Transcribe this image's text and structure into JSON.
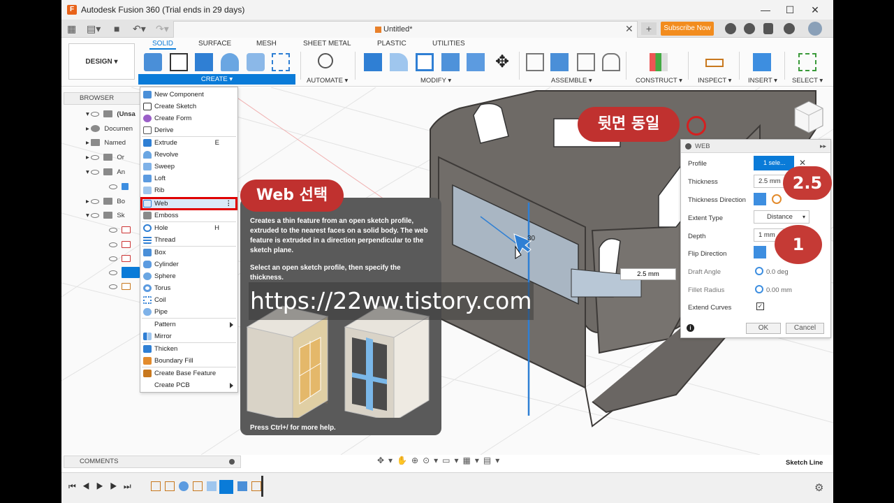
{
  "window": {
    "title": "Autodesk Fusion 360 (Trial ends in 29 days)"
  },
  "tab": {
    "doc_title": "Untitled*",
    "subscribe": "Subscribe Now"
  },
  "ribbon": {
    "workspace": "DESIGN ▾",
    "tabs": [
      "SOLID",
      "SURFACE",
      "MESH",
      "SHEET METAL",
      "PLASTIC",
      "UTILITIES"
    ],
    "groups": [
      "CREATE ▾",
      "AUTOMATE ▾",
      "MODIFY ▾",
      "ASSEMBLE ▾",
      "CONSTRUCT ▾",
      "INSPECT ▾",
      "INSERT ▾",
      "SELECT ▾"
    ]
  },
  "browser": {
    "title": "BROWSER",
    "rows": [
      "(Unsa",
      "Documen",
      "Named",
      "Or",
      "An",
      "Bo",
      "Sk"
    ]
  },
  "create_menu": {
    "items": [
      {
        "label": "New Component",
        "key": ""
      },
      {
        "label": "Create Sketch",
        "key": ""
      },
      {
        "label": "Create Form",
        "key": ""
      },
      {
        "label": "Derive",
        "key": ""
      },
      {
        "label": "Extrude",
        "key": "E"
      },
      {
        "label": "Revolve",
        "key": ""
      },
      {
        "label": "Sweep",
        "key": ""
      },
      {
        "label": "Loft",
        "key": ""
      },
      {
        "label": "Rib",
        "key": ""
      },
      {
        "label": "Web",
        "key": ""
      },
      {
        "label": "Emboss",
        "key": ""
      },
      {
        "label": "Hole",
        "key": "H"
      },
      {
        "label": "Thread",
        "key": ""
      },
      {
        "label": "Box",
        "key": ""
      },
      {
        "label": "Cylinder",
        "key": ""
      },
      {
        "label": "Sphere",
        "key": ""
      },
      {
        "label": "Torus",
        "key": ""
      },
      {
        "label": "Coil",
        "key": ""
      },
      {
        "label": "Pipe",
        "key": ""
      },
      {
        "label": "Pattern",
        "key": ""
      },
      {
        "label": "Mirror",
        "key": ""
      },
      {
        "label": "Thicken",
        "key": ""
      },
      {
        "label": "Boundary Fill",
        "key": ""
      },
      {
        "label": "Create Base Feature",
        "key": ""
      },
      {
        "label": "Create PCB",
        "key": ""
      }
    ]
  },
  "tooltip": {
    "p1": "Creates a thin feature from an open sketch profile, extruded to the nearest faces on a solid body. The web feature is extruded in a direction perpendicular to the sketch plane.",
    "p2": "Select an open sketch profile, then specify the thickness.",
    "footer": "Press Ctrl+/ for more help."
  },
  "annotations": {
    "web_select": "Web 선택",
    "back_same": "뒷면 동일",
    "thickness_value": "2.5",
    "depth_value": "1",
    "url": "https://22ww.tistory.com"
  },
  "web_panel": {
    "title": "WEB",
    "profile_label": "Profile",
    "profile_value": "1 sele...",
    "thickness_label": "Thickness",
    "thickness_value": "2.5 mm",
    "thickness_dir_label": "Thickness Direction",
    "extent_label": "Extent Type",
    "extent_value": "Distance",
    "depth_label": "Depth",
    "depth_value": "1 mm",
    "flip_label": "Flip Direction",
    "draft_label": "Draft Angle",
    "draft_value": "0.0 deg",
    "fillet_label": "Fillet Radius",
    "fillet_value": "0.00 mm",
    "extend_label": "Extend Curves",
    "ok": "OK",
    "cancel": "Cancel"
  },
  "viewport": {
    "dim_input": "2.5 mm",
    "dim_label": "30",
    "sketch_status": "Sketch Line"
  },
  "comments": {
    "title": "COMMENTS"
  },
  "colors": {
    "accent": "#0a7bd8",
    "callout": "#c0312f",
    "highlight": "#e00000",
    "subscribe": "#f28c1e"
  }
}
